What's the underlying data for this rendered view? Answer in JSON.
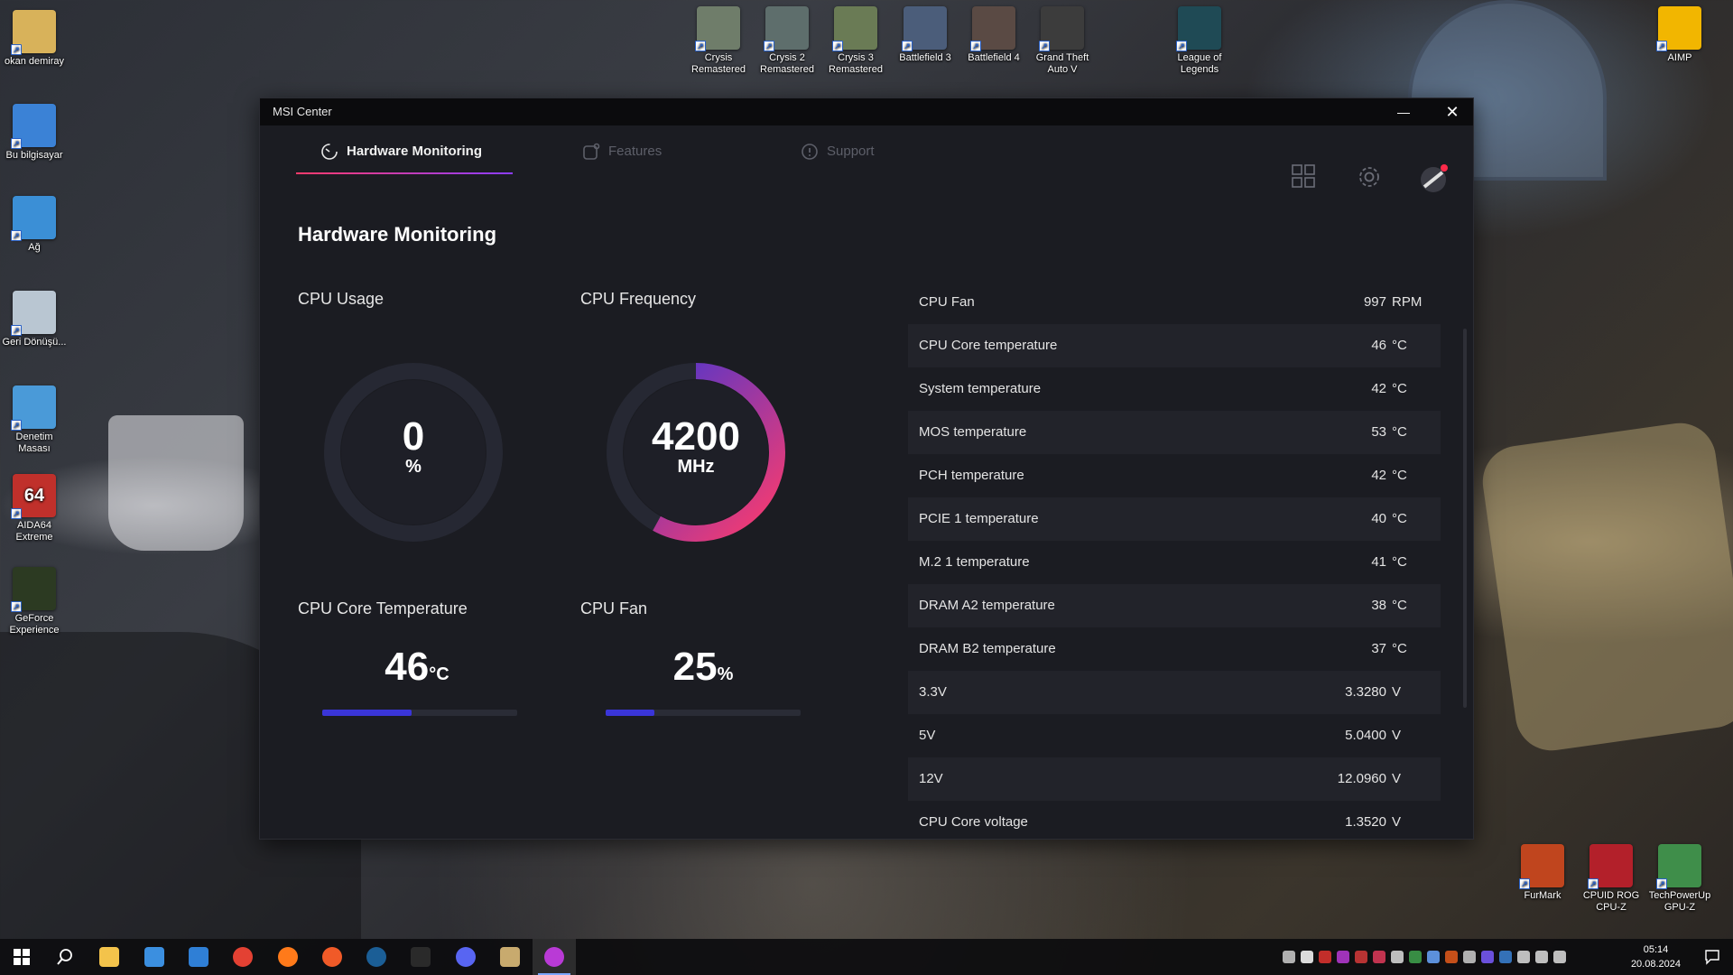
{
  "desktop": {
    "top_icons": [
      {
        "label": "Crysis Remastered",
        "color": "#6f7d6a"
      },
      {
        "label": "Crysis 2 Remastered",
        "color": "#5e6e6c"
      },
      {
        "label": "Crysis 3 Remastered",
        "color": "#6a7b55"
      },
      {
        "label": "Battlefield 3",
        "color": "#4b5d7a"
      },
      {
        "label": "Battlefield 4",
        "color": "#5a4a44"
      },
      {
        "label": "Grand Theft Auto V",
        "color": "#3c3c3c"
      },
      {
        "label": "League of Legends",
        "color": "#1f4a55"
      },
      {
        "label": "AIMP",
        "color": "#f2b600"
      }
    ],
    "left_icons": [
      {
        "label": "okan demiray",
        "color": "#d8b25a"
      },
      {
        "label": "Bu bilgisayar",
        "color": "#3b82d6"
      },
      {
        "label": "Ağ",
        "color": "#3b8fd6"
      },
      {
        "label": "Geri Dönüşü...",
        "color": "#b9c6d2"
      },
      {
        "label": "Denetim Masası",
        "color": "#4a9ad8"
      },
      {
        "label": "AIDA64 Extreme",
        "color": "#c0302b",
        "glyph": "64"
      },
      {
        "label": "GeForce Experience",
        "color": "#2c3a22"
      }
    ],
    "bottom_right_icons": [
      {
        "label": "FurMark",
        "color": "#c0451e"
      },
      {
        "label": "CPUID ROG CPU-Z",
        "color": "#b3202a"
      },
      {
        "label": "TechPowerUp GPU-Z",
        "color": "#3f8e4a"
      }
    ]
  },
  "window": {
    "title": "MSI Center",
    "minimize_glyph": "—",
    "close_glyph": "✕",
    "tabs": [
      {
        "label": "Hardware Monitoring"
      },
      {
        "label": "Features"
      },
      {
        "label": "Support"
      }
    ],
    "section_title": "Hardware Monitoring",
    "gauges": {
      "cpu_usage": {
        "label": "CPU Usage",
        "value": "0",
        "unit": "%",
        "fraction": 0
      },
      "cpu_frequency": {
        "label": "CPU Frequency",
        "value": "4200",
        "unit": "MHz",
        "fraction": 0.58
      }
    },
    "bars": {
      "cpu_core_temp": {
        "label": "CPU Core Temperature",
        "value": "46",
        "unit": "°C",
        "fraction": 0.46
      },
      "cpu_fan": {
        "label": "CPU Fan",
        "value": "25",
        "unit": "%",
        "fraction": 0.25
      }
    },
    "sensors": [
      {
        "name": "CPU Fan",
        "value": "997",
        "unit": "RPM"
      },
      {
        "name": "CPU Core temperature",
        "value": "46",
        "unit": "°C"
      },
      {
        "name": "System temperature",
        "value": "42",
        "unit": "°C"
      },
      {
        "name": "MOS temperature",
        "value": "53",
        "unit": "°C"
      },
      {
        "name": "PCH temperature",
        "value": "42",
        "unit": "°C"
      },
      {
        "name": "PCIE 1 temperature",
        "value": "40",
        "unit": "°C"
      },
      {
        "name": "M.2 1 temperature",
        "value": "41",
        "unit": "°C"
      },
      {
        "name": "DRAM A2 temperature",
        "value": "38",
        "unit": "°C"
      },
      {
        "name": "DRAM B2 temperature",
        "value": "37",
        "unit": "°C"
      },
      {
        "name": "3.3V",
        "value": "3.3280",
        "unit": "V"
      },
      {
        "name": "5V",
        "value": "5.0400",
        "unit": "V"
      },
      {
        "name": "12V",
        "value": "12.0960",
        "unit": "V"
      },
      {
        "name": "CPU Core voltage",
        "value": "1.3520",
        "unit": "V"
      }
    ],
    "accent": {
      "gradient_start": "#ff3b6b",
      "gradient_end": "#3a35d8",
      "bar": "#3a35d8"
    }
  },
  "taskbar": {
    "apps": [
      {
        "name": "start",
        "icon": "windows-logo-icon",
        "color": "#ffffff"
      },
      {
        "name": "search",
        "icon": "search-icon",
        "color": "#ffffff"
      },
      {
        "name": "file-explorer",
        "icon": "folder-icon",
        "color": "#f3c34b"
      },
      {
        "name": "store",
        "icon": "store-icon",
        "color": "#3b8fe0"
      },
      {
        "name": "mail",
        "icon": "mail-icon",
        "color": "#2f7fd6"
      },
      {
        "name": "chrome",
        "icon": "chrome-icon",
        "color": "#e34133"
      },
      {
        "name": "firefox",
        "icon": "firefox-icon",
        "color": "#ff7a1a"
      },
      {
        "name": "ea",
        "icon": "ea-icon",
        "color": "#f05a28"
      },
      {
        "name": "steam",
        "icon": "steam-icon",
        "color": "#1b5e96"
      },
      {
        "name": "epic",
        "icon": "epic-games-icon",
        "color": "#2a2a2a"
      },
      {
        "name": "discord",
        "icon": "discord-icon",
        "color": "#5865f2"
      },
      {
        "name": "league",
        "icon": "league-icon",
        "color": "#c8aa6e"
      },
      {
        "name": "msi-center",
        "icon": "msi-center-icon",
        "color": "#b93ad6"
      }
    ],
    "tray_colors": [
      "#cccccc",
      "#ffffff",
      "#e2342f",
      "#b93ad6",
      "#d63a3a",
      "#e03a5a",
      "#dddddd",
      "#3fa34d",
      "#6aa7ff",
      "#e55b1b",
      "#cccccc",
      "#7a5cff",
      "#3b82d6",
      "#dddddd",
      "#dddddd",
      "#dddddd"
    ],
    "clock_time": "05:14",
    "clock_date": "20.08.2024"
  }
}
